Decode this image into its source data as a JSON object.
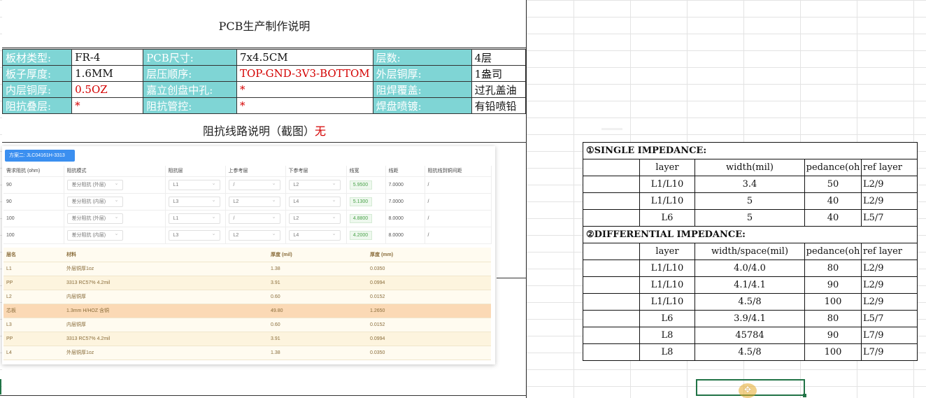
{
  "doc": {
    "title": "PCB生产制作说明",
    "spec_rows": [
      [
        {
          "t": "板材类型:",
          "k": "lab"
        },
        {
          "t": "FR-4",
          "k": "val"
        },
        {
          "t": "PCB尺寸:",
          "k": "lab"
        },
        {
          "t": "7x4.5CM",
          "k": "val"
        },
        {
          "t": "层数:",
          "k": "lab"
        },
        {
          "t": "4层",
          "k": "val"
        }
      ],
      [
        {
          "t": "板子厚度:",
          "k": "lab"
        },
        {
          "t": "1.6MM",
          "k": "val"
        },
        {
          "t": "层压顺序:",
          "k": "lab"
        },
        {
          "t": "TOP-GND-3V3-BOTTOM",
          "k": "red"
        },
        {
          "t": "外层铜厚:",
          "k": "lab"
        },
        {
          "t": "1盎司",
          "k": "val"
        }
      ],
      [
        {
          "t": "内层铜厚:",
          "k": "lab"
        },
        {
          "t": "0.5OZ",
          "k": "red"
        },
        {
          "t": "嘉立创盘中孔:",
          "k": "lab"
        },
        {
          "t": "*",
          "k": "red"
        },
        {
          "t": "阻焊覆盖:",
          "k": "lab"
        },
        {
          "t": "过孔盖油",
          "k": "val"
        }
      ],
      [
        {
          "t": "阻抗叠层:",
          "k": "lab"
        },
        {
          "t": "*",
          "k": "red"
        },
        {
          "t": "阻抗管控:",
          "k": "lab"
        },
        {
          "t": "*",
          "k": "red"
        },
        {
          "t": "焊盘喷镀:",
          "k": "lab"
        },
        {
          "t": "有铅喷铅",
          "k": "val"
        }
      ]
    ],
    "impedance_title": "阻抗线路说明（截图）",
    "impedance_title_red": "无"
  },
  "screenshot": {
    "plan_button": "方案二: JLC04161H-3313",
    "headers": [
      "需求阻抗 (ohm)",
      "阻抗模式",
      "阻抗层",
      "上参考层",
      "下参考层",
      "线宽",
      "线距",
      "阻抗线到铜间距"
    ],
    "rows": [
      [
        "90",
        "差分阻抗 (外层)",
        "L1",
        "/",
        "L2",
        "5.9500",
        "7.0000",
        "/"
      ],
      [
        "90",
        "差分阻抗 (内层)",
        "L3",
        "L2",
        "L4",
        "5.1300",
        "7.0000",
        "/"
      ],
      [
        "100",
        "差分阻抗 (外层)",
        "L1",
        "/",
        "L2",
        "4.8800",
        "8.0000",
        "/"
      ],
      [
        "100",
        "差分阻抗 (内层)",
        "L3",
        "L2",
        "L4",
        "4.2000",
        "8.0000",
        "/"
      ]
    ],
    "stack_headers": [
      "层名",
      "材料",
      "厚度 (mil)",
      "厚度 (mm)"
    ],
    "stack_rows": [
      [
        "L1",
        "外层铜厚1oz",
        "1.38",
        "0.0350"
      ],
      [
        "PP",
        "3313 RC57% 4.2mil",
        "3.91",
        "0.0994"
      ],
      [
        "L2",
        "内层铜厚",
        "0.60",
        "0.0152"
      ],
      [
        "芯板",
        "1.3mm H/HOZ 含铜",
        "49.80",
        "1.2650"
      ],
      [
        "L3",
        "内层铜厚",
        "0.60",
        "0.0152"
      ],
      [
        "PP",
        "3313 RC57% 4.2mil",
        "3.91",
        "0.0994"
      ],
      [
        "L4",
        "外层铜厚1oz",
        "1.38",
        "0.0350"
      ]
    ]
  },
  "impedance": {
    "single_title": "①SINGLE   IMPEDANCE:",
    "single_headers": [
      "",
      "layer",
      "width(mil)",
      "pedance(oh",
      "ref layer"
    ],
    "single_rows": [
      [
        "",
        "L1/L10",
        "3.4",
        "50",
        "L2/9"
      ],
      [
        "",
        "L1/L10",
        "5",
        "40",
        "L2/9"
      ],
      [
        "",
        "L6",
        "5",
        "40",
        "L5/7"
      ]
    ],
    "diff_title": "②DIFFERENTIAL  IMPEDANCE:",
    "diff_headers": [
      "",
      "layer",
      "width/space(mil)",
      "pedance(oh",
      "ref layer"
    ],
    "diff_rows": [
      [
        "",
        "L1/L10",
        "4.0/4.0",
        "80",
        "L2/9"
      ],
      [
        "",
        "L1/L10",
        "4.1/4.1",
        "90",
        "L2/9"
      ],
      [
        "",
        "L1/L10",
        "4.5/8",
        "100",
        "L2/9"
      ],
      [
        "",
        "L6",
        "3.9/4.1",
        "80",
        "L5/7"
      ],
      [
        "",
        "L8",
        "45784",
        "90",
        "L7/9"
      ],
      [
        "",
        "L8",
        "4.5/8",
        "100",
        "L7/9"
      ]
    ]
  },
  "cursor_icon": "move-cross-icon",
  "colors": {
    "label_bg": "#7fd5d5",
    "red": "#d40000",
    "select": "#217346",
    "plan_button": "#3b8ff0"
  }
}
